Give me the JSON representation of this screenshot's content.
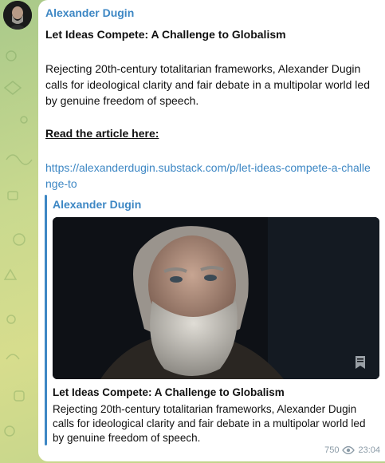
{
  "message": {
    "sender": "Alexander Dugin",
    "title": "Let Ideas Compete: A Challenge to Globalism",
    "body": "Rejecting 20th-century totalitarian frameworks, Alexander Dugin calls for ideological clarity and fair debate in a multipolar world led by genuine freedom of speech.",
    "read_label": "Read the article here:",
    "url": "https://alexanderdugin.substack.com/p/let-ideas-compete-a-challenge-to"
  },
  "preview": {
    "site_name": "Alexander Dugin",
    "title": "Let Ideas Compete: A Challenge to Globalism",
    "description": "Rejecting 20th-century totalitarian frameworks, Alexander Dugin calls for ideological clarity and fair debate in a multipolar world led by genuine freedom of speech."
  },
  "meta": {
    "views": "750",
    "time": "23:04"
  },
  "icons": {
    "views": "eye-icon",
    "save": "bookmark-icon"
  },
  "colors": {
    "link": "#3d87c4",
    "meta": "#8a9aa6"
  }
}
